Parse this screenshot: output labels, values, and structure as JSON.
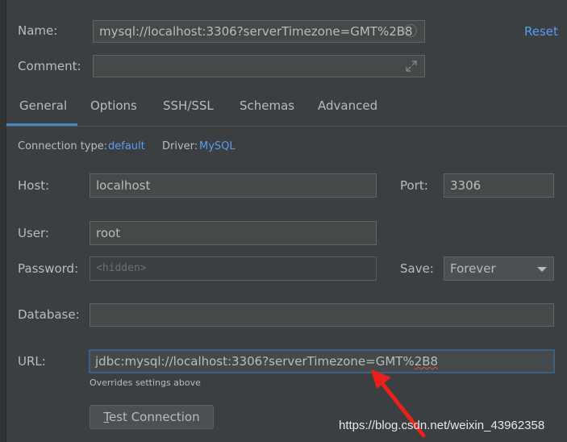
{
  "colors": {
    "background": "#3c3f41",
    "accent": "#4a88c7",
    "link": "#589df6",
    "arrow": "#e8211c"
  },
  "name": {
    "label": "Name:",
    "value": "mysql://localhost:3306?serverTimezone=GMT%2B8"
  },
  "reset_label": "Reset",
  "comment": {
    "label": "Comment:",
    "value": ""
  },
  "tabs": [
    {
      "label": "General",
      "active": true
    },
    {
      "label": "Options"
    },
    {
      "label": "SSH/SSL"
    },
    {
      "label": "Schemas"
    },
    {
      "label": "Advanced"
    }
  ],
  "connection_type": {
    "label": "Connection type:",
    "value": "default"
  },
  "driver": {
    "label": "Driver:",
    "value": "MySQL"
  },
  "host": {
    "label": "Host:",
    "value": "localhost"
  },
  "port": {
    "label": "Port:",
    "value": "3306"
  },
  "user": {
    "label": "User:",
    "value": "root"
  },
  "password": {
    "label": "Password:",
    "placeholder": "<hidden>"
  },
  "save": {
    "label": "Save:",
    "value": "Forever"
  },
  "database": {
    "label": "Database:",
    "value": ""
  },
  "url": {
    "label": "URL:",
    "value_prefix": "jdbc:mysql://localhost:3306?serverTimezone=GMT%",
    "value_suffix": "2B8",
    "hint": "Overrides settings above"
  },
  "test_connection": {
    "mnemonic": "T",
    "rest": "est Connection"
  },
  "watermark": "https://blog.csdn.net/weixin_43962358"
}
